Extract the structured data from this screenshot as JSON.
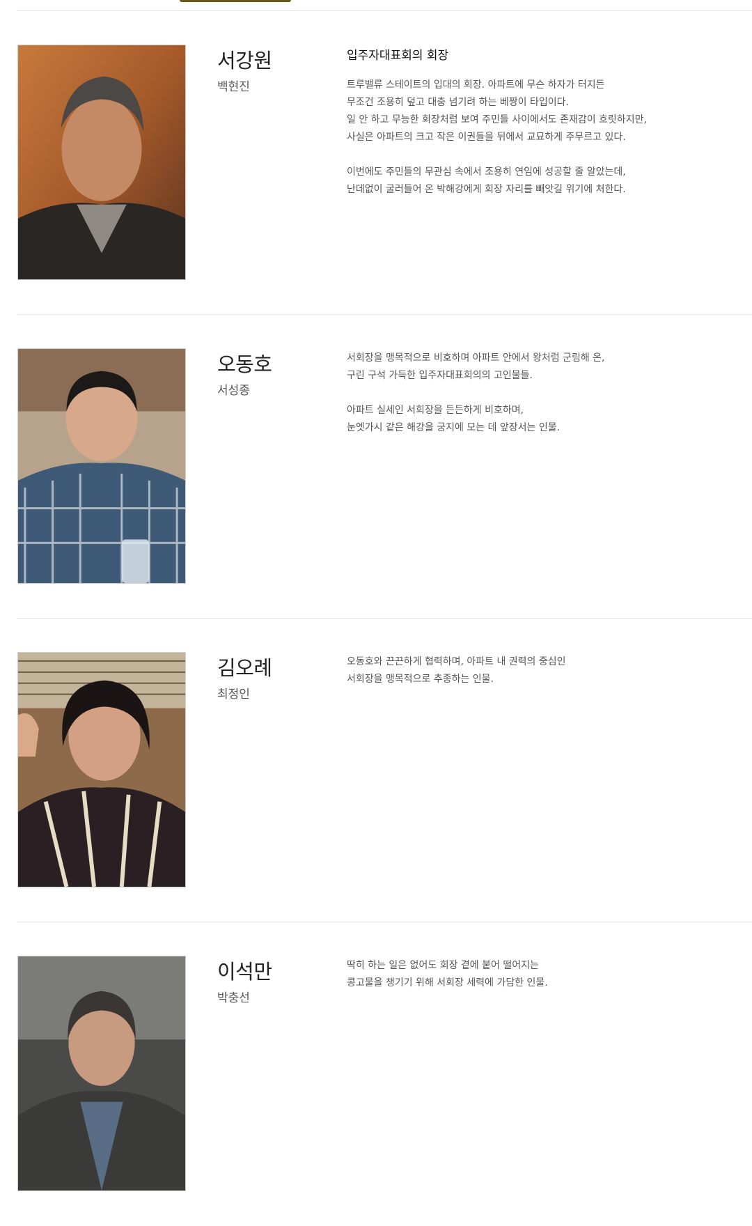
{
  "cast": [
    {
      "role": "서강원",
      "actor": "백현진",
      "title": "입주자대표회의 회장",
      "paragraphs": [
        "트루밸류 스테이트의 입대의 회장. 아파트에 무슨 하자가 터지든\n무조건 조용히 덮고 대충 넘기려 하는 베짱이 타입이다.\n일 안 하고 무능한 회장처럼 보여 주민들 사이에서도 존재감이 흐릿하지만,\n사실은 아파트의 크고 작은 이권들을 뒤에서 교묘하게 주무르고 있다.",
        "이번에도 주민들의 무관심 속에서 조용히 연임에 성공할 줄 알았는데,\n난데없이 굴러들어 온 박해강에게 회장 자리를 빼앗길 위기에 처한다."
      ]
    },
    {
      "role": "오동호",
      "actor": "서성종",
      "title": "",
      "paragraphs": [
        "서회장을 맹목적으로 비호하며 아파트 안에서 왕처럼 군림해 온,\n구린 구석 가득한 입주자대표회의의 고인물들.",
        "아파트 실세인 서회장을 든든하게 비호하며,\n눈엣가시 같은 해강을 궁지에 모는 데 앞장서는 인물."
      ]
    },
    {
      "role": "김오례",
      "actor": "최정인",
      "title": "",
      "paragraphs": [
        "오동호와 끈끈하게 협력하며, 아파트 내 권력의 중심인\n서회장을 맹목적으로 추종하는 인물."
      ]
    },
    {
      "role": "이석만",
      "actor": "박충선",
      "title": "",
      "paragraphs": [
        "딱히 하는 일은 없어도 회장 곁에 붙어 떨어지는\n콩고물을 챙기기 위해 서회장 세력에 가담한 인물."
      ]
    }
  ],
  "colors": {
    "divider": "#e6e6e6",
    "tab_accent": "#6b5a1e"
  }
}
